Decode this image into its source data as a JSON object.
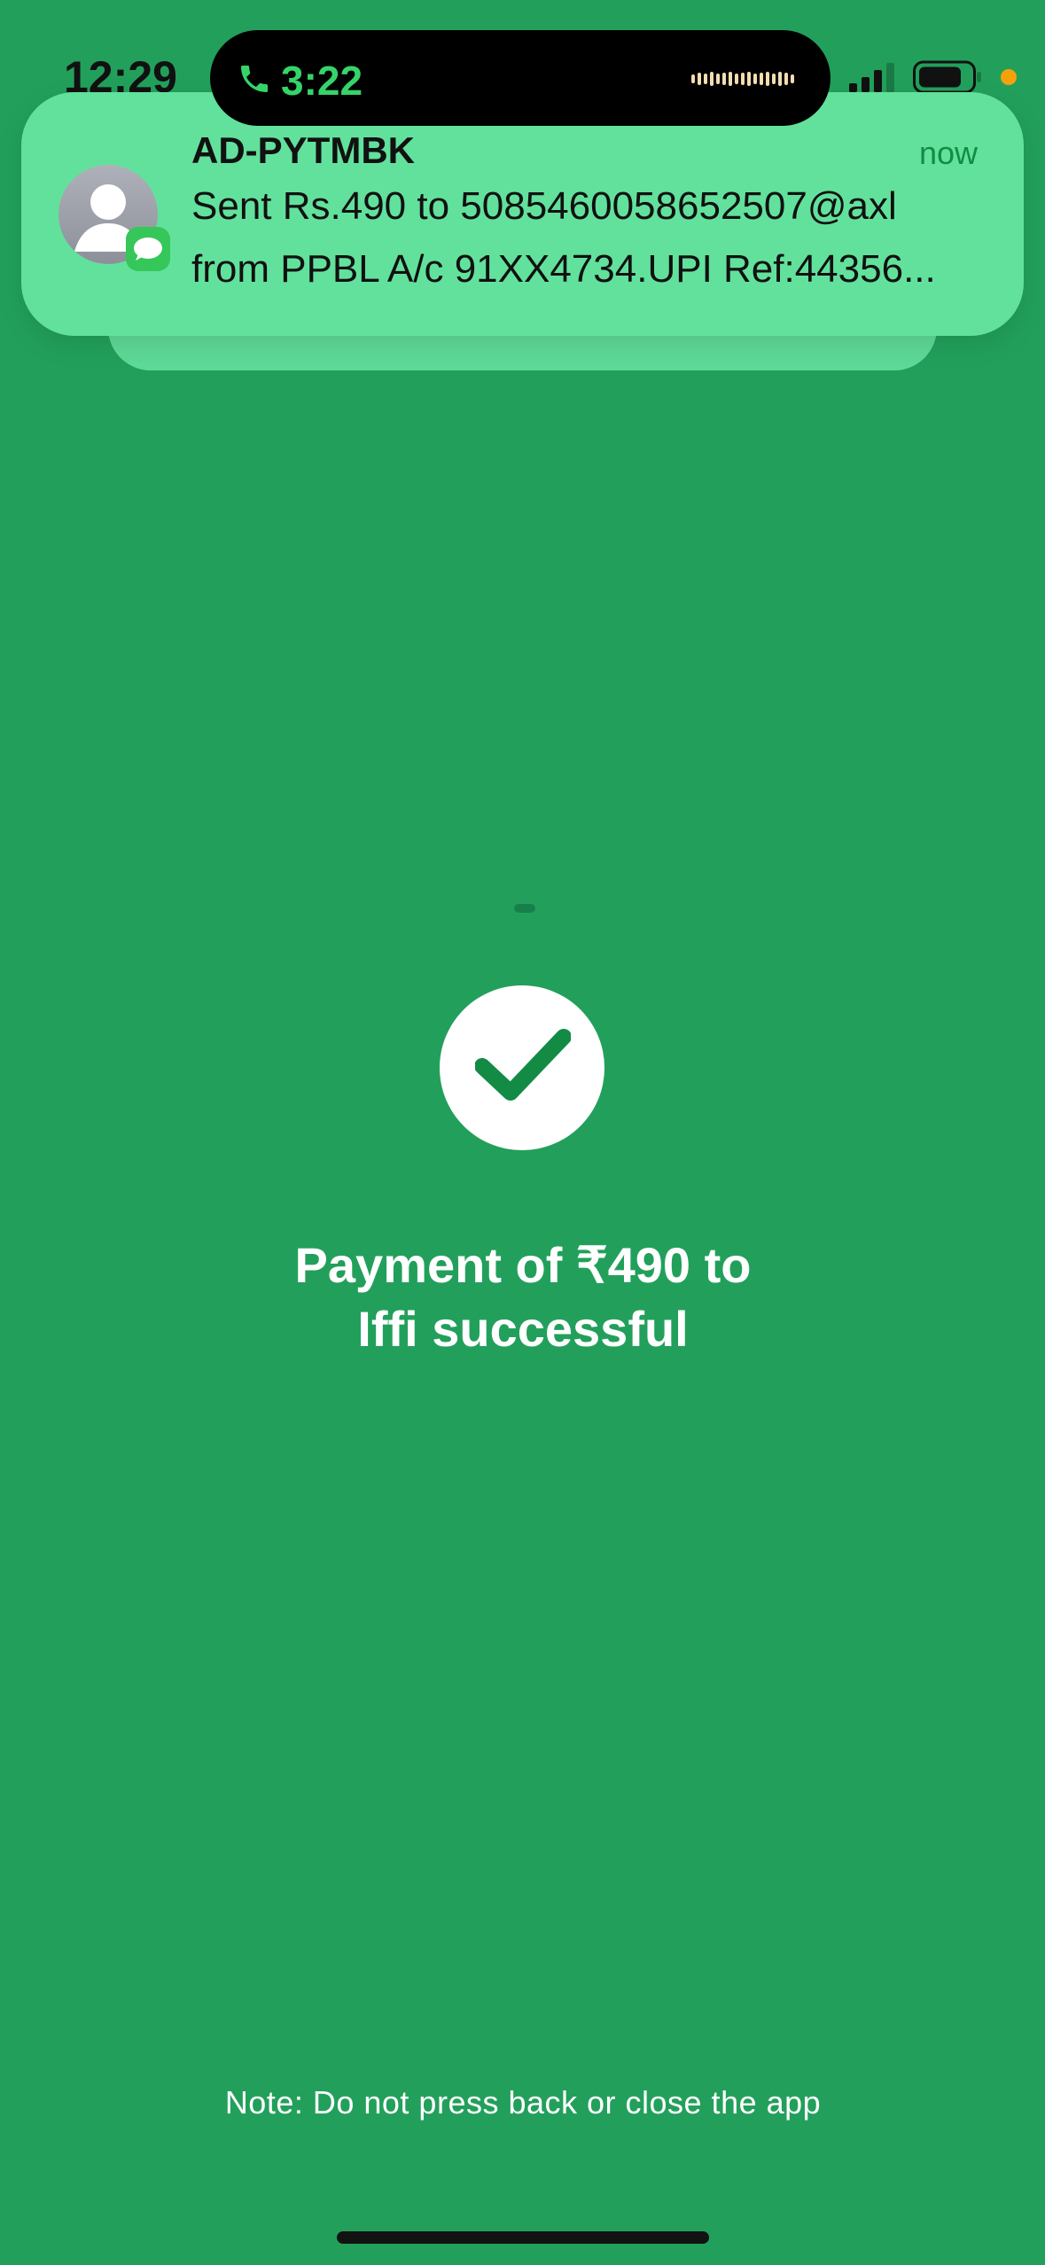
{
  "status_bar": {
    "time": "12:29",
    "call_timer": "3:22",
    "call_icon": "phone-icon",
    "waveform_icon": "audio-waveform-icon",
    "signal_icon": "cellular-signal-icon",
    "battery_icon": "battery-icon",
    "privacy_indicator_color": "#f5a10a"
  },
  "notification": {
    "sender": "AD-PYTMBK",
    "time": "now",
    "line1": "Sent Rs.490 to 5085460058652507@axl",
    "line2": "from PPBL A/c 91XX4734.UPI Ref:44356...",
    "avatar_icon": "contact-avatar-icon",
    "app_icon": "messages-app-icon"
  },
  "payment": {
    "status_icon": "checkmark-icon",
    "message_line1": "Payment of ₹490 to",
    "message_line2": "Iffi successful"
  },
  "footer": {
    "note": "Note: Do not press back or close the app"
  },
  "colors": {
    "background": "#22a05b",
    "notification_bg": "#62e19c",
    "success_accent": "#138b45",
    "call_green": "#35d46a"
  }
}
